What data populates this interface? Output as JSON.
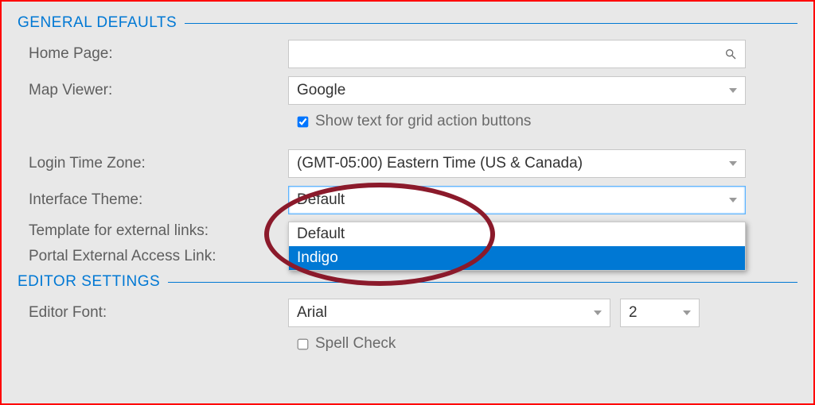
{
  "sections": {
    "general": {
      "title": "GENERAL DEFAULTS"
    },
    "editor": {
      "title": "EDITOR SETTINGS"
    }
  },
  "general": {
    "home_page_label": "Home Page:",
    "home_page_value": "",
    "map_viewer_label": "Map Viewer:",
    "map_viewer_value": "Google",
    "grid_text_label": "Show text for grid action buttons",
    "grid_text_checked": true,
    "login_tz_label": "Login Time Zone:",
    "login_tz_value": "(GMT-05:00) Eastern Time (US & Canada)",
    "theme_label": "Interface Theme:",
    "theme_value": "Default",
    "theme_options": [
      "Default",
      "Indigo"
    ],
    "theme_highlighted": "Indigo",
    "template_ext_label": "Template for external links:",
    "portal_ext_label": "Portal External Access Link:"
  },
  "editor": {
    "font_label": "Editor Font:",
    "font_value": "Arial",
    "font_size_value": "2",
    "spell_label": "Spell Check",
    "spell_checked": false
  },
  "icons": {
    "search": "search-icon",
    "caret": "chevron-down-icon"
  },
  "colors": {
    "accent": "#0078d4",
    "annotation": "#8b1a2b",
    "border_frame": "#ff0000"
  }
}
